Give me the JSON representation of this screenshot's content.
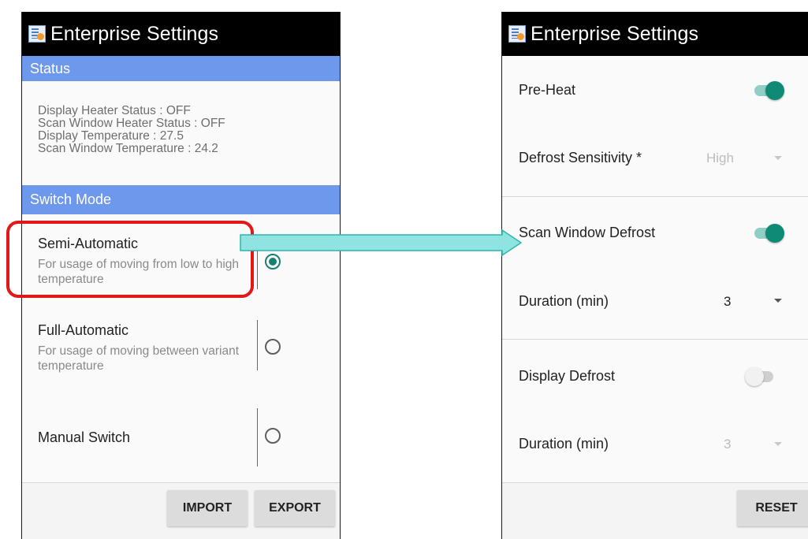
{
  "left": {
    "title": "Enterprise Settings",
    "status_header": "Status",
    "status_lines": [
      "Display Heater Status : OFF",
      "Scan Window Heater Status : OFF",
      "Display Temperature : 27.5",
      "Scan Window Temperature : 24.2"
    ],
    "switch_header": "Switch Mode",
    "modes": [
      {
        "title": "Semi-Automatic",
        "desc": "For usage of moving from low to high temperature",
        "selected": true
      },
      {
        "title": "Full-Automatic",
        "desc": "For usage of moving between variant temperature",
        "selected": false
      },
      {
        "title": "Manual Switch",
        "desc": "",
        "selected": false
      }
    ],
    "buttons": {
      "import": "IMPORT",
      "export": "EXPORT"
    }
  },
  "right": {
    "title": "Enterprise Settings",
    "pre_heat": {
      "label": "Pre-Heat",
      "on": true
    },
    "defrost_sensitivity": {
      "label": "Defrost Sensitivity *",
      "value": "High",
      "enabled": false
    },
    "scan_window_defrost": {
      "label": "Scan Window Defrost",
      "on": true
    },
    "scan_duration": {
      "label": "Duration (min)",
      "value": "3",
      "enabled": true
    },
    "display_defrost": {
      "label": "Display Defrost",
      "on": false
    },
    "display_duration": {
      "label": "Duration (min)",
      "value": "3",
      "enabled": false
    },
    "buttons": {
      "reset": "RESET"
    }
  },
  "colors": {
    "section_header": "#6d98ec",
    "accent": "#0f8a77",
    "highlight": "#e21818",
    "arrow_fill": "#8fe3e0"
  },
  "icons": {
    "app": "enterprise-settings-app-icon",
    "checked_radio": "radio-checked-icon",
    "unchecked_radio": "radio-unchecked-icon",
    "dropdown": "chevron-down-icon",
    "annotation_arrow": "right-arrow-icon"
  }
}
